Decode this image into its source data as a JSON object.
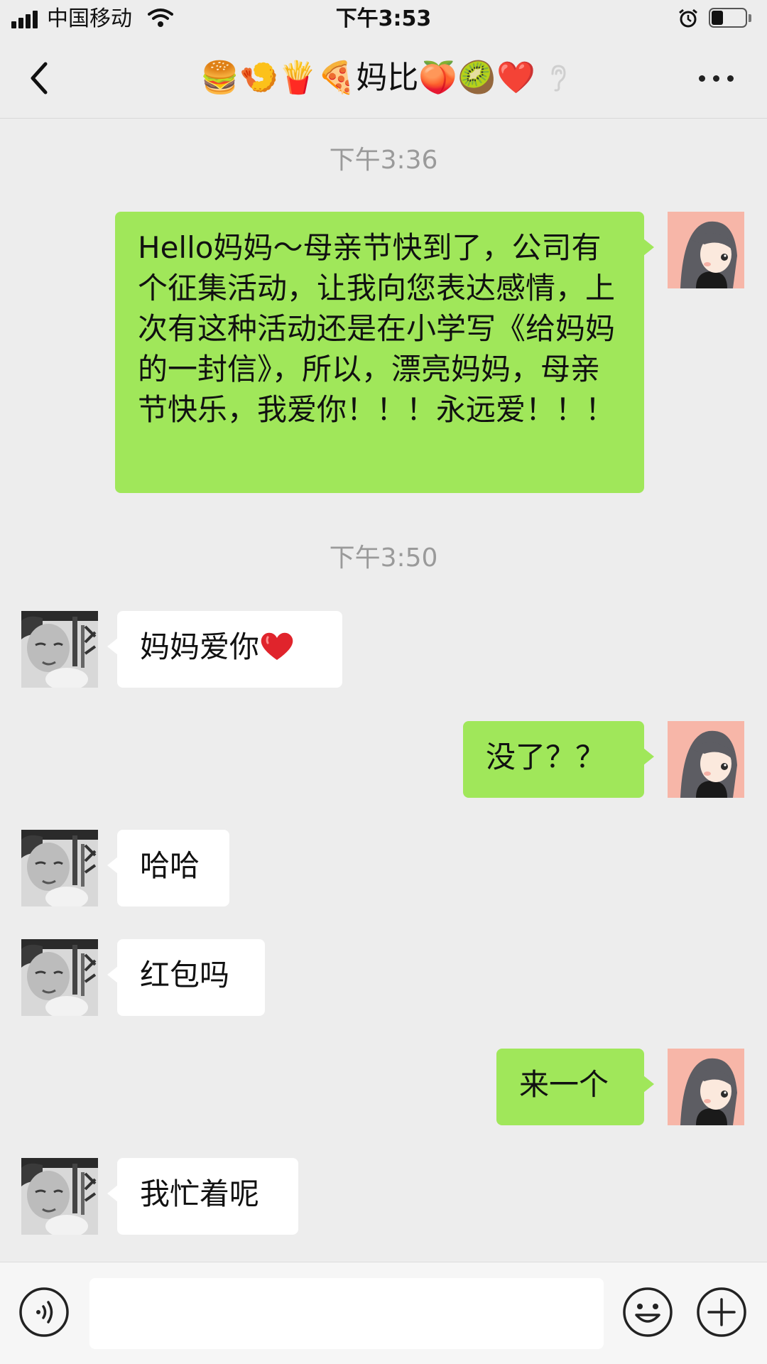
{
  "status_bar": {
    "carrier": "中国移动",
    "time": "下午3:53",
    "battery_level_percent": 35
  },
  "header": {
    "title": "🍔🍤🍟🍕妈比🍑🥝❤️",
    "ear_icon": "ear-icon",
    "back_icon": "chevron-left-icon",
    "more_icon": "more-dots-icon"
  },
  "messages": [
    {
      "type": "timestamp",
      "text": "下午3:36"
    },
    {
      "type": "outgoing",
      "text": "Hello妈妈～母亲节快到了，公司有个征集活动，让我向您表达感情，上次有这种活动还是在小学写《给妈妈的一封信》，所以，漂亮妈妈，母亲节快乐，我爱你！！！永远爱！！！"
    },
    {
      "type": "timestamp",
      "text": "下午3:50"
    },
    {
      "type": "incoming",
      "text": "妈妈爱你",
      "emoji": "❤️"
    },
    {
      "type": "outgoing",
      "text": "没了？？"
    },
    {
      "type": "incoming",
      "text": "哈哈"
    },
    {
      "type": "incoming",
      "text": "红包吗"
    },
    {
      "type": "outgoing",
      "text": "来一个"
    },
    {
      "type": "incoming",
      "text": "我忙着呢"
    }
  ],
  "input_bar": {
    "voice_icon": "voice-icon",
    "emoji_icon": "emoji-icon",
    "plus_icon": "plus-icon",
    "placeholder": ""
  },
  "colors": {
    "background": "#ededed",
    "outgoing_bubble": "#a0e75a",
    "incoming_bubble": "#ffffff",
    "timestamp_text": "#9a9a9a",
    "heart": "#e0242c"
  }
}
